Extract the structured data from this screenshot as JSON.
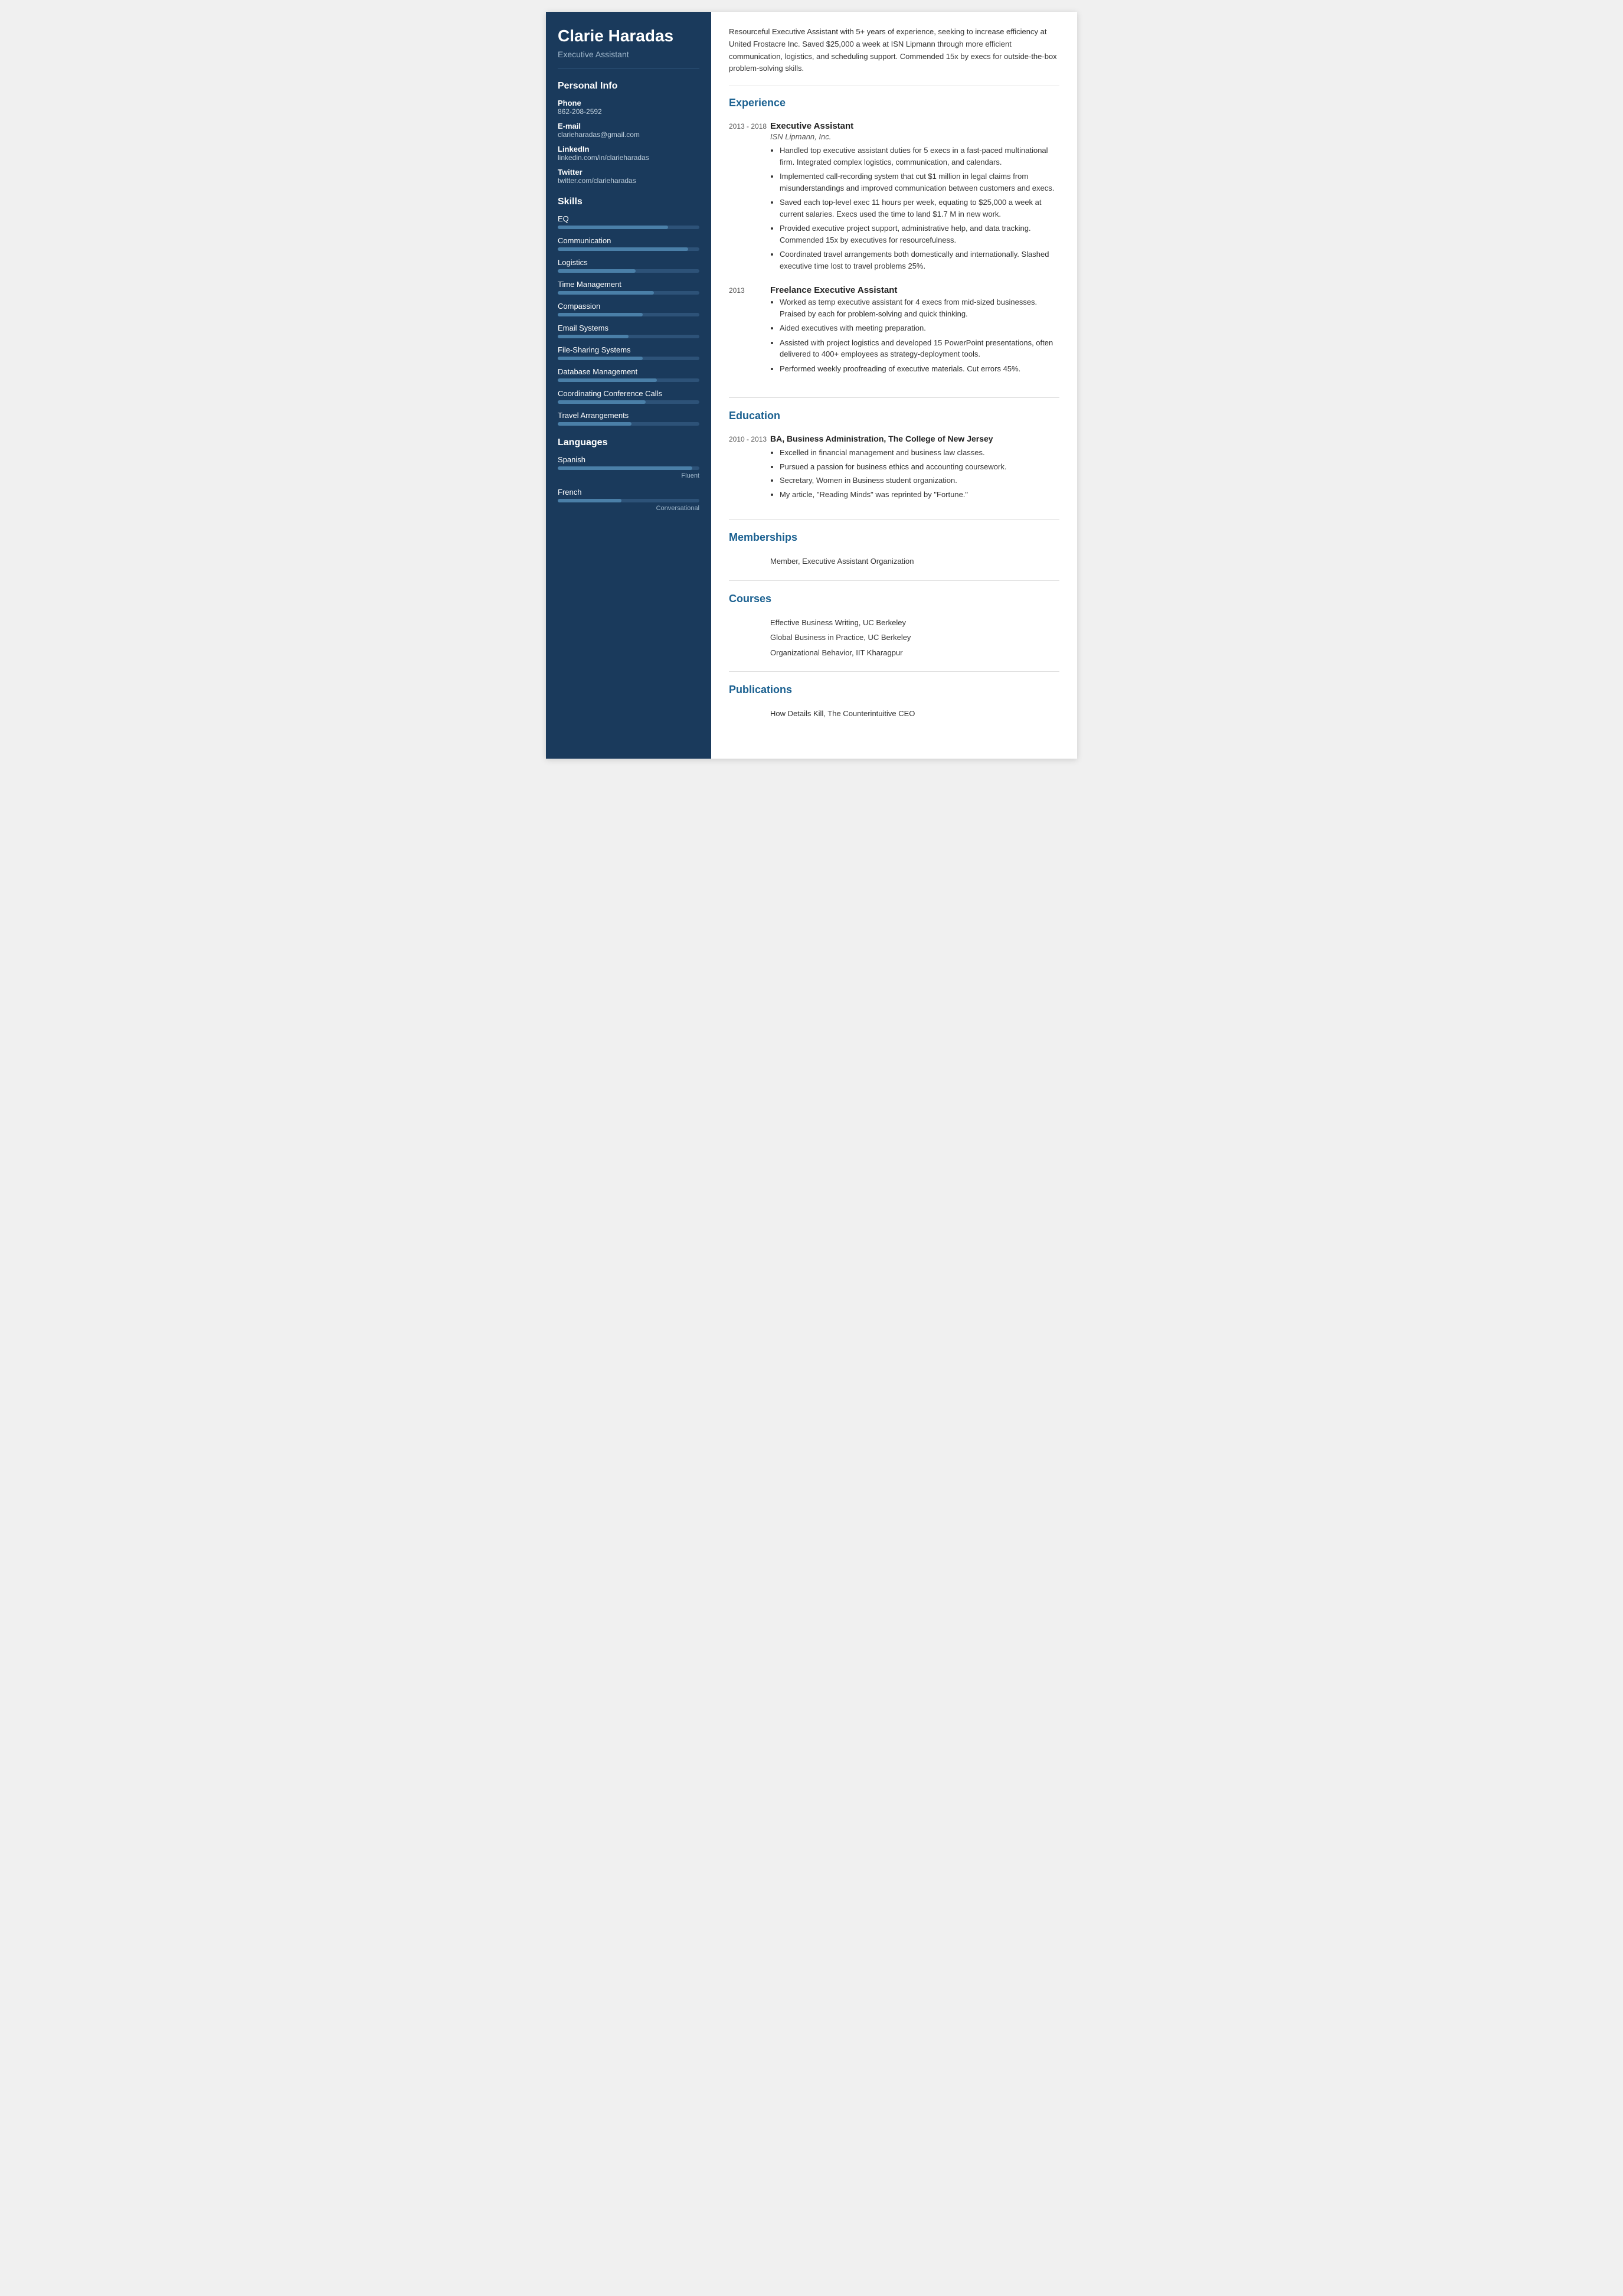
{
  "sidebar": {
    "name": "Clarie Haradas",
    "title": "Executive Assistant",
    "personal_info_title": "Personal Info",
    "phone_label": "Phone",
    "phone": "862-208-2592",
    "email_label": "E-mail",
    "email": "clarieharadas@gmail.com",
    "linkedin_label": "LinkedIn",
    "linkedin": "linkedin.com/in/clarieharadas",
    "twitter_label": "Twitter",
    "twitter": "twitter.com/clarieharadas",
    "skills_title": "Skills",
    "skills": [
      {
        "name": "EQ",
        "pct": 78
      },
      {
        "name": "Communication",
        "pct": 92
      },
      {
        "name": "Logistics",
        "pct": 55
      },
      {
        "name": "Time Management",
        "pct": 68
      },
      {
        "name": "Compassion",
        "pct": 60
      },
      {
        "name": "Email Systems",
        "pct": 50
      },
      {
        "name": "File-Sharing Systems",
        "pct": 60
      },
      {
        "name": "Database Management",
        "pct": 70
      },
      {
        "name": "Coordinating Conference Calls",
        "pct": 62
      },
      {
        "name": "Travel Arrangements",
        "pct": 52
      }
    ],
    "languages_title": "Languages",
    "languages": [
      {
        "name": "Spanish",
        "pct": 95,
        "level": "Fluent"
      },
      {
        "name": "French",
        "pct": 45,
        "level": "Conversational"
      }
    ]
  },
  "main": {
    "summary": "Resourceful Executive Assistant with 5+ years of experience, seeking to increase efficiency at United Frostacre Inc. Saved $25,000 a week at ISN Lipmann through more efficient communication, logistics, and scheduling support. Commended 15x by execs for outside-the-box problem-solving skills.",
    "experience_title": "Experience",
    "experience": [
      {
        "date": "2013 - 2018",
        "title": "Executive Assistant",
        "company": "ISN Lipmann, Inc.",
        "bullets": [
          "Handled top executive assistant duties for 5 execs in a fast-paced multinational firm. Integrated complex logistics, communication, and calendars.",
          "Implemented call-recording system that cut $1 million in legal claims from misunderstandings and improved communication between customers and execs.",
          "Saved each top-level exec 11 hours per week, equating to $25,000 a week at current salaries. Execs used the time to land $1.7 M in new work.",
          "Provided executive project support, administrative help, and data tracking. Commended 15x by executives for resourcefulness.",
          "Coordinated travel arrangements both domestically and internationally. Slashed executive time lost to travel problems 25%."
        ]
      },
      {
        "date": "2013",
        "title": "Freelance Executive Assistant",
        "company": "",
        "bullets": [
          "Worked as temp executive assistant for 4 execs from mid-sized businesses. Praised by each for problem-solving and quick thinking.",
          "Aided executives with meeting preparation.",
          "Assisted with project logistics and developed 15 PowerPoint presentations, often delivered to 400+ employees as strategy-deployment tools.",
          "Performed weekly proofreading of executive materials. Cut errors 45%."
        ]
      }
    ],
    "education_title": "Education",
    "education": [
      {
        "date": "2010 - 2013",
        "degree": "BA, Business Administration, The College of New Jersey",
        "bullets": [
          "Excelled in financial management and business law classes.",
          "Pursued a passion for business ethics and accounting coursework.",
          "Secretary, Women in Business student organization.",
          "My article, \"Reading Minds\" was reprinted by \"Fortune.\""
        ]
      }
    ],
    "memberships_title": "Memberships",
    "memberships": [
      "Member, Executive Assistant Organization"
    ],
    "courses_title": "Courses",
    "courses": [
      "Effective Business Writing, UC Berkeley",
      "Global Business in Practice, UC Berkeley",
      "Organizational Behavior, IIT Kharagpur"
    ],
    "publications_title": "Publications",
    "publications": [
      "How Details Kill, The Counterintuitive CEO"
    ]
  }
}
